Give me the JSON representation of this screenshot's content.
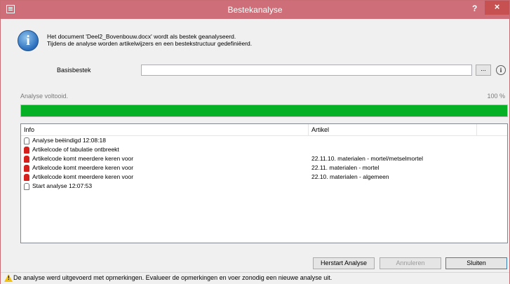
{
  "window": {
    "title": "Bestekanalyse",
    "help_label": "?",
    "close_label": "×"
  },
  "message": {
    "line1": "Het document 'Deel2_Bovenbouw.docx' wordt als bestek geanalyseerd.",
    "line2": "Tijdens de analyse worden artikelwijzers en een bestekstructuur gedefiniëerd."
  },
  "basisbestek": {
    "label": "Basisbestek",
    "value": "",
    "browse_label": "...",
    "info_label": "i"
  },
  "progress": {
    "status": "Analyse voltooid.",
    "percent_text": "100 %",
    "value": 1.0
  },
  "list": {
    "columns": [
      "Info",
      "Artikel"
    ],
    "rows": [
      {
        "icon": "document-icon",
        "info": "Analyse beëindigd 12:08:18",
        "artikel": ""
      },
      {
        "icon": "error-bell-icon",
        "info": "Artikelcode of tabulatie ontbreekt",
        "artikel": ""
      },
      {
        "icon": "error-bell-icon",
        "info": "Artikelcode komt meerdere keren voor",
        "artikel": "22.11.10. materialen - mortel/metselmortel"
      },
      {
        "icon": "error-bell-icon",
        "info": "Artikelcode komt meerdere keren voor",
        "artikel": "22.11. materialen - mortel"
      },
      {
        "icon": "error-bell-icon",
        "info": "Artikelcode komt meerdere keren voor",
        "artikel": "22.10. materialen - algemeen"
      },
      {
        "icon": "document-icon",
        "info": "Start analyse 12:07:53",
        "artikel": ""
      }
    ]
  },
  "buttons": {
    "restart": "Herstart Analyse",
    "cancel": "Annuleren",
    "close": "Sluiten"
  },
  "statusbar": {
    "text": "De analyse werd uitgevoerd met opmerkingen. Evalueer de opmerkingen en voer zonodig een nieuwe analyse uit."
  },
  "colors": {
    "titlebar": "#cd6e78",
    "progress": "#06b025",
    "error": "#d6201b"
  }
}
